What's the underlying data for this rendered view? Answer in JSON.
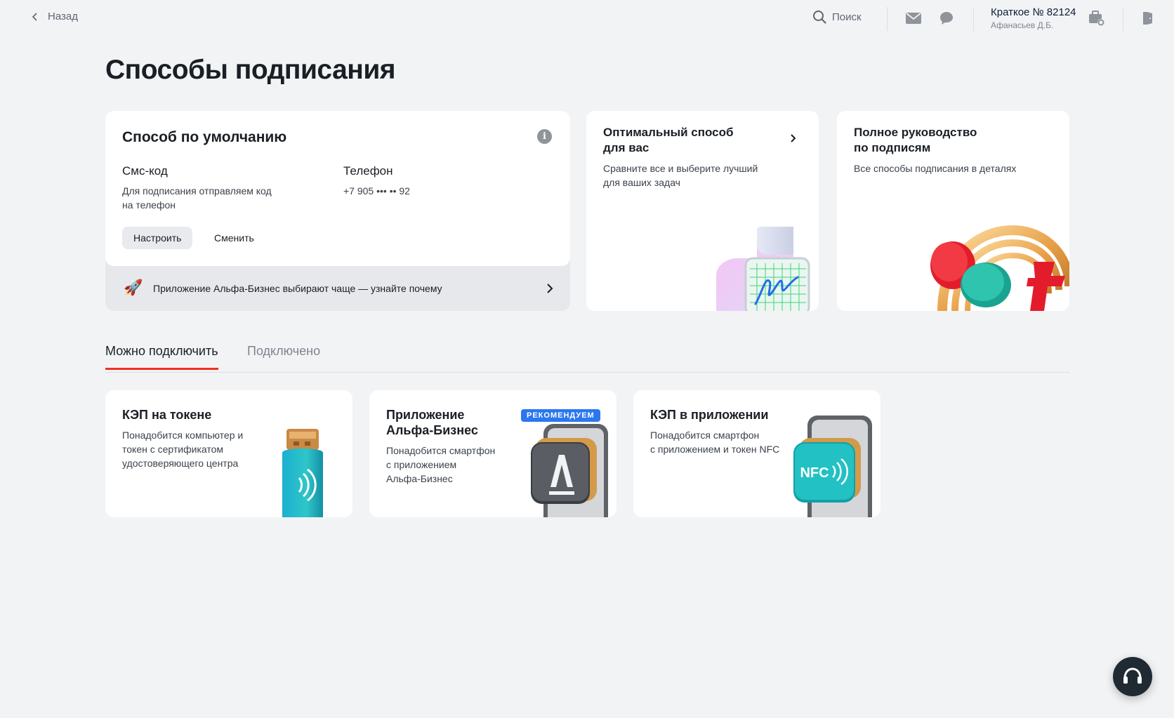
{
  "topbar": {
    "back_label": "Назад",
    "search_label": "Поиск",
    "company_name": "Краткое № 82124",
    "company_person": "Афанасьев Д.Б."
  },
  "page": {
    "title": "Способы подписания"
  },
  "default_method": {
    "title": "Способ по умолчанию",
    "sms_head": "Смс-код",
    "sms_desc": "Для подписания отправляем код на телефон",
    "phone_head": "Телефон",
    "phone_value": "+7 905 ••• •• 92",
    "configure_label": "Настроить",
    "change_label": "Сменить",
    "promo_text": "Приложение Альфа-Бизнес выбирают чаще — узнайте почему"
  },
  "info_cards": [
    {
      "title_line1": "Оптимальный способ",
      "title_line2": "для вас",
      "desc_line1": "Сравните все и выберите лучший",
      "desc_line2": "для ваших задач"
    },
    {
      "title_line1": "Полное руководство",
      "title_line2": "по подписям",
      "desc_line1": "Все способы подписания в деталях"
    }
  ],
  "tabs": [
    {
      "label": "Можно подключить",
      "active": true
    },
    {
      "label": "Подключено",
      "active": false
    }
  ],
  "methods": [
    {
      "title": "КЭП на токене",
      "desc": [
        "Понадобится компьютер и",
        "токен с сертификатом",
        "удостоверяющего центра"
      ]
    },
    {
      "title_line1": "Приложение",
      "title_line2": "Альфа-Бизнес",
      "badge": "РЕКОМЕНДУЕМ",
      "desc": [
        "Понадобится смартфон",
        "с приложением",
        "Альфа-Бизнес"
      ]
    },
    {
      "title": "КЭП в приложении",
      "desc": [
        "Понадобится смартфон",
        "с приложением и токен NFC"
      ],
      "nfc_label": "NFC"
    }
  ],
  "colors": {
    "accent": "#ef3124",
    "badge": "#2a77ef",
    "background": "#f2f3f5"
  }
}
